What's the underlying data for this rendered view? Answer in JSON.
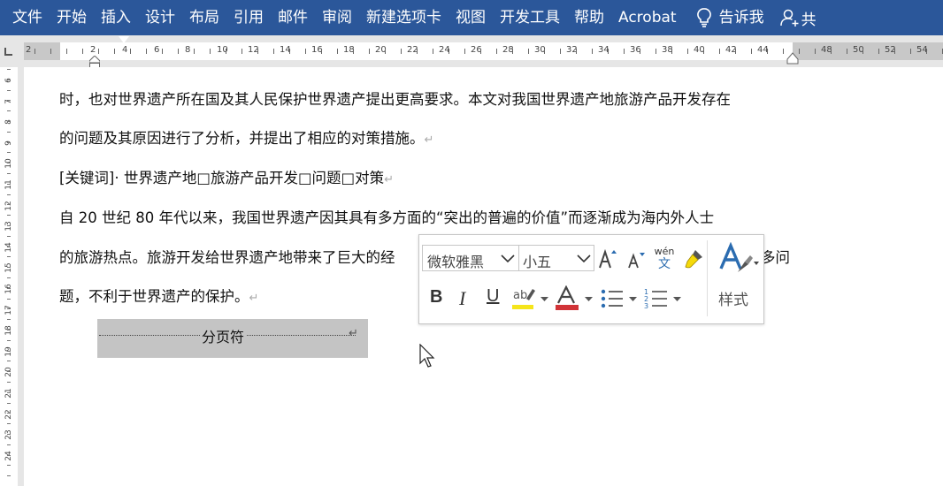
{
  "ribbon": {
    "tabs": [
      {
        "label": "文件"
      },
      {
        "label": "开始"
      },
      {
        "label": "插入"
      },
      {
        "label": "设计"
      },
      {
        "label": "布局"
      },
      {
        "label": "引用"
      },
      {
        "label": "邮件"
      },
      {
        "label": "审阅"
      },
      {
        "label": "新建选项卡"
      },
      {
        "label": "视图"
      },
      {
        "label": "开发工具"
      },
      {
        "label": "帮助"
      },
      {
        "label": "Acrobat"
      }
    ],
    "tell_me": "告诉我",
    "share_cut": "共"
  },
  "ruler": {
    "numbers": [
      "2",
      "2",
      "4",
      "6",
      "8",
      "10",
      "12",
      "14",
      "16",
      "18",
      "20",
      "22",
      "24",
      "26",
      "28",
      "30",
      "32",
      "34",
      "36",
      "38",
      "40",
      "42",
      "44",
      "48",
      "50",
      "52",
      "54"
    ],
    "vertical_numbers": [
      "6",
      "7",
      "8",
      "9",
      "10",
      "11",
      "12",
      "13",
      "14",
      "15",
      "16",
      "17",
      "18",
      "19",
      "20",
      "21",
      "22",
      "23",
      "24"
    ]
  },
  "document": {
    "lines": [
      {
        "text": "时，也对世界遗产所在国及其人民保护世界遗产提出更高要求。本文对我国世界遗产地旅游产品开发存在"
      },
      {
        "text": "的问题及其原因进行了分析，并提出了相应的对策措施。"
      },
      {
        "text": "[关键词]· 世界遗产地□旅游产品开发□问题□对策"
      },
      {
        "text": "自 20 世纪 80 年代以来，我国世界遗产因其具有多方面的“突出的普遍的价值”而逐渐成为海内外人士"
      },
      {
        "text": "的旅游热点。旅游开发给世界遗产地带来了巨大的经"
      },
      {
        "text": "题，不利于世界遗产的保护。"
      }
    ],
    "line4_tail": "多问",
    "para_mark": "↵",
    "page_break_label": "分页符"
  },
  "mini_toolbar": {
    "font_name": "微软雅黑",
    "font_size": "小五",
    "style_label": "样式",
    "phonetic_top": "wén",
    "phonetic_bottom": "文",
    "highlight_color": "#f5e51b",
    "font_color": "#d13438"
  }
}
